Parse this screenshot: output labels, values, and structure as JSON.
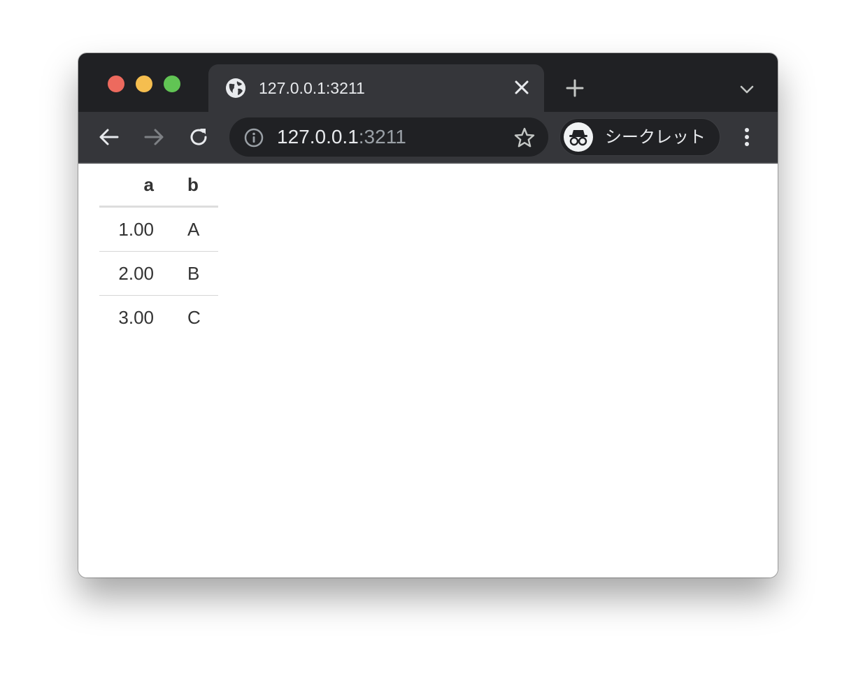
{
  "tab": {
    "title": "127.0.0.1:3211"
  },
  "omnibox": {
    "host": "127.0.0.1",
    "port": ":3211"
  },
  "profile": {
    "label": "シークレット"
  },
  "table": {
    "headers": [
      "a",
      "b"
    ],
    "rows": [
      [
        "1.00",
        "A"
      ],
      [
        "2.00",
        "B"
      ],
      [
        "3.00",
        "C"
      ]
    ]
  },
  "icons": {
    "tab_favicon": "globe-icon",
    "tab_close": "close-icon",
    "new_tab": "plus-icon",
    "tab_search": "chevron-down-icon",
    "back": "arrow-left-icon",
    "forward": "arrow-right-icon",
    "reload": "reload-icon",
    "site_info": "info-icon",
    "bookmark": "star-icon",
    "incognito": "incognito-icon",
    "menu": "more-vertical-icon"
  },
  "colors": {
    "tabstrip_bg": "#202124",
    "toolbar_bg": "#35363a",
    "traffic_close": "#ed6a5e",
    "traffic_minimize": "#f5be4f",
    "traffic_maximize": "#61c454",
    "text_light": "#e8eaed",
    "text_dim": "#9aa0a6",
    "table_text": "#333333"
  }
}
